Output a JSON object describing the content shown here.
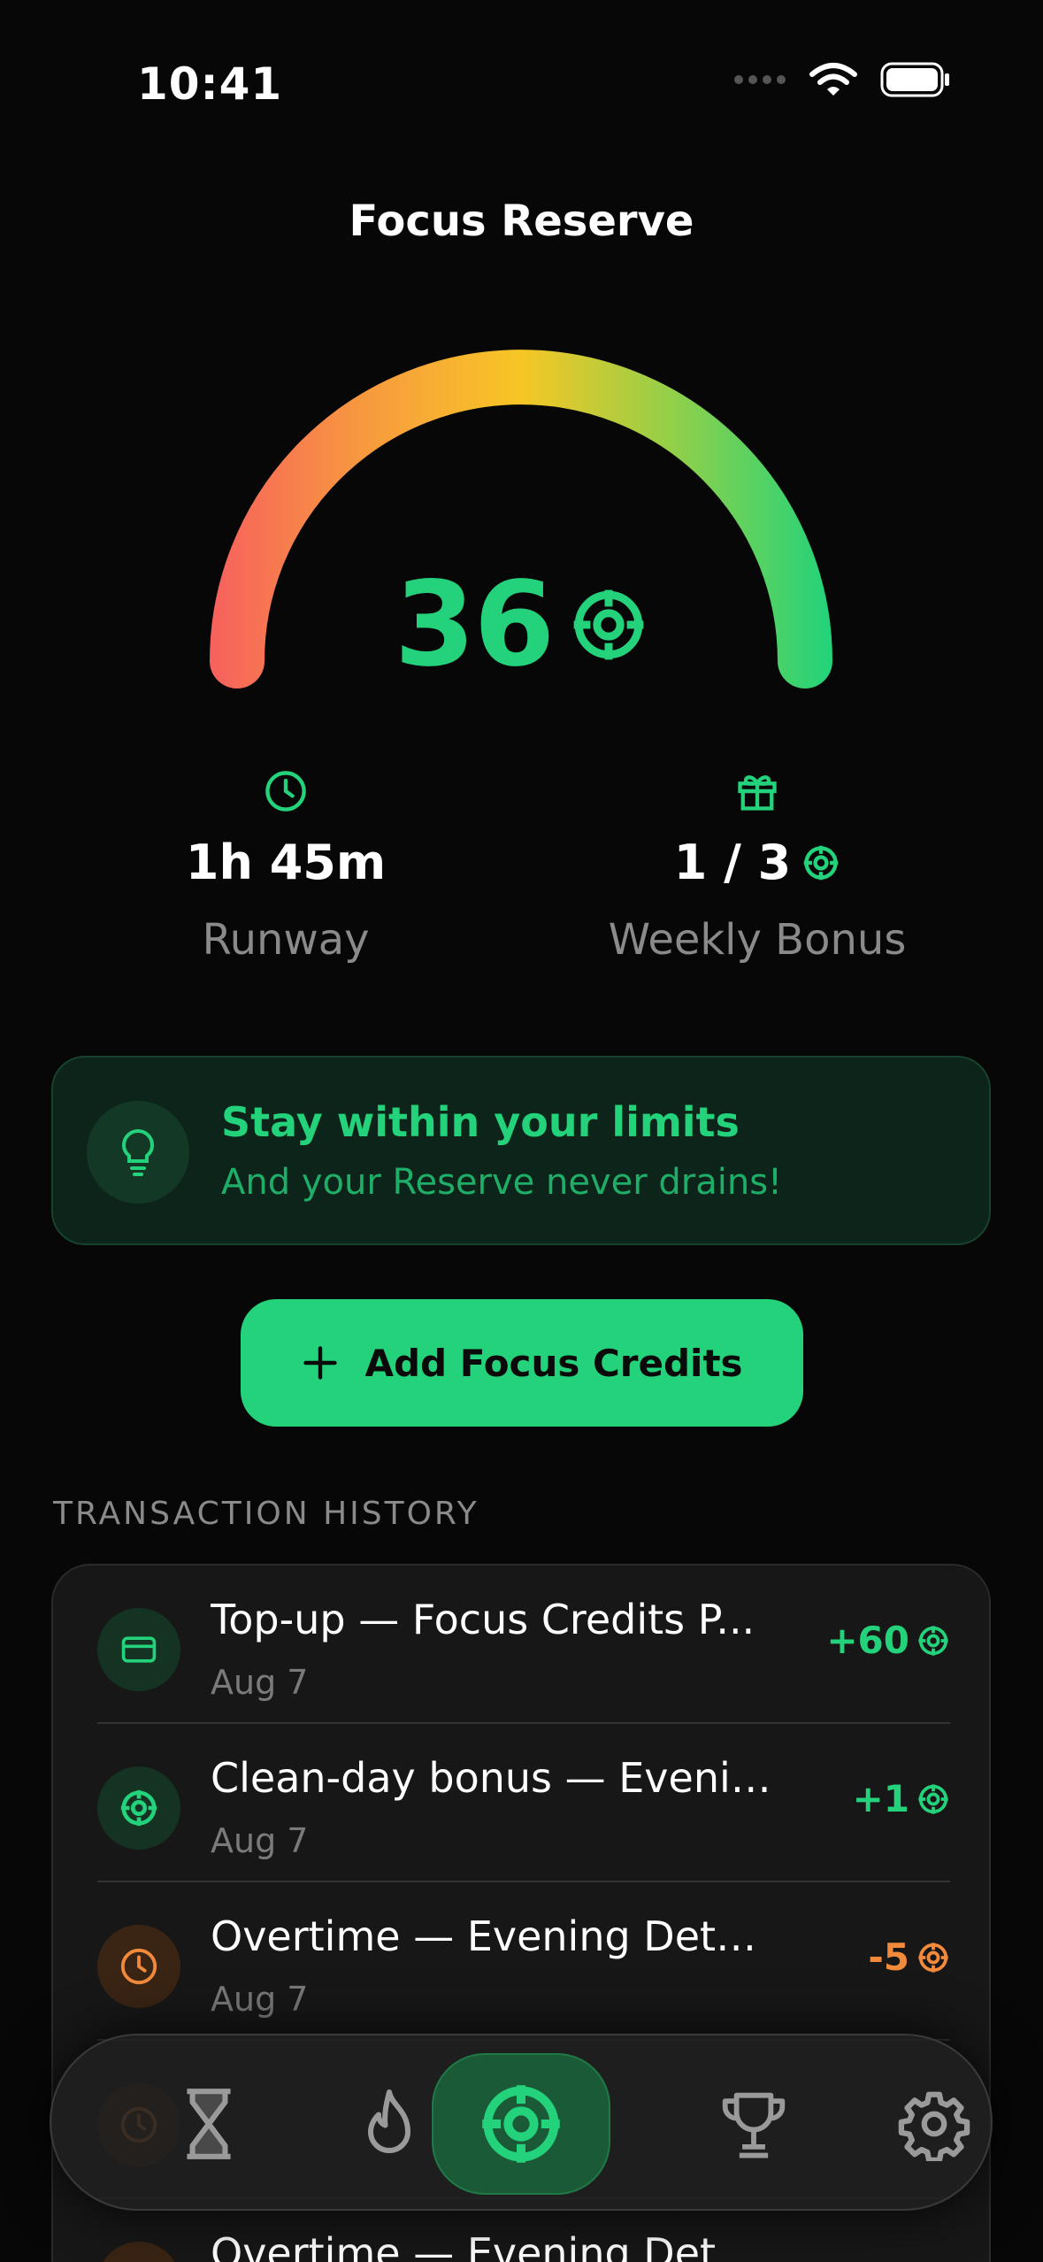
{
  "status_bar": {
    "time": "10:41"
  },
  "header": {
    "title": "Focus Reserve"
  },
  "gauge": {
    "value": "36",
    "fraction": 1.0
  },
  "stats": {
    "runway": {
      "value": "1h 45m",
      "label": "Runway"
    },
    "weekly_bonus": {
      "value": "1 / 3",
      "label": "Weekly Bonus"
    }
  },
  "tip": {
    "title": "Stay within your limits",
    "subtitle": "And your Reserve never drains!"
  },
  "actions": {
    "add_label": "Add Focus Credits"
  },
  "history": {
    "label": "TRANSACTION HISTORY",
    "items": [
      {
        "title": "Top-up — Focus Credits P...",
        "date": "Aug 7",
        "amount": "+60",
        "kind": "topup"
      },
      {
        "title": "Clean-day bonus — Evenin...",
        "date": "Aug 7",
        "amount": "+1",
        "kind": "bonus"
      },
      {
        "title": "Overtime — Evening Detox IV",
        "date": "Aug 7",
        "amount": "-5",
        "kind": "overtime"
      },
      {
        "title": "",
        "date": "",
        "amount": "",
        "kind": "overtime"
      },
      {
        "title": "Overtime — Evening Detox IV",
        "date": "",
        "amount": "",
        "kind": "overtime"
      }
    ]
  },
  "tabs": [
    {
      "icon": "hourglass-icon"
    },
    {
      "icon": "flame-icon"
    },
    {
      "icon": "target-icon",
      "active": true
    },
    {
      "icon": "trophy-icon"
    },
    {
      "icon": "gear-icon"
    }
  ],
  "colors": {
    "accent": "#23d27a",
    "warning": "#f28a3c",
    "background": "#070707"
  }
}
